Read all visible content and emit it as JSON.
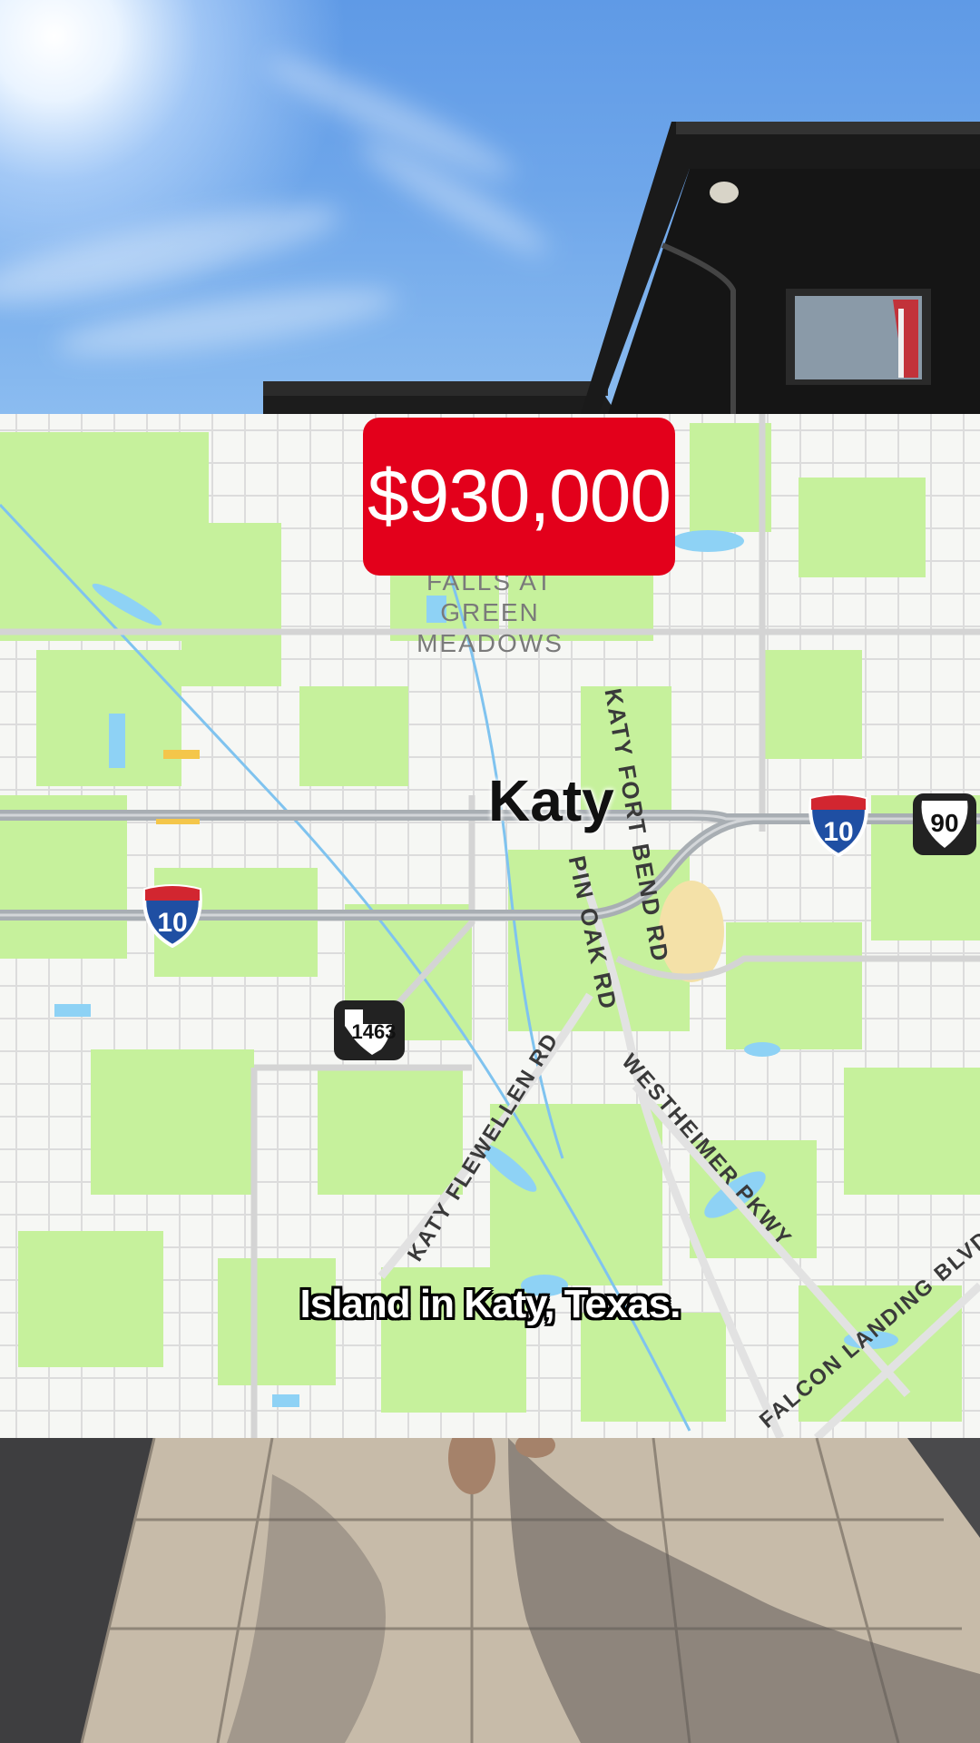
{
  "listing": {
    "price": "$930,000"
  },
  "map": {
    "city": "Katy",
    "poi": "FALLS AT GREEN MEADOWS",
    "roads": {
      "katy_fort_bend": "KATY FORT BEND RD",
      "pin_oak": "PIN OAK RD",
      "katy_flewellen": "KATY FLEWELLEN RD",
      "westheimer": "WESTHEIMER PKWY",
      "falcon_landing": "FALCON LANDING BLVD"
    },
    "shields": {
      "interstate": "10",
      "us_route": "90",
      "texas_route": "1463"
    },
    "colors": {
      "park_green": "#c6f19c",
      "water_blue": "#8ed2f5",
      "highway_gray": "#a8aeb3",
      "interstate_red": "#d22630",
      "interstate_blue": "#1f4fa3"
    }
  },
  "caption": {
    "text": "Island in Katy, Texas."
  }
}
